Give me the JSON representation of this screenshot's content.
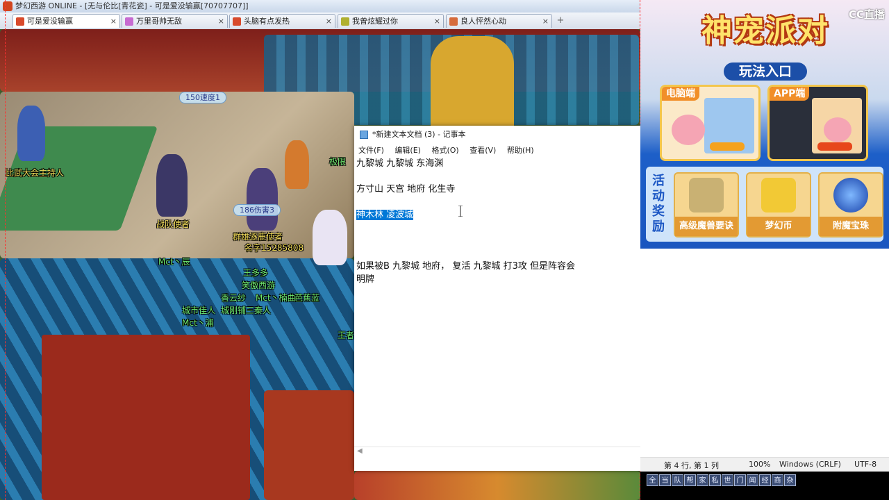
{
  "game_window": {
    "title": "梦幻西游 ONLINE - [无与伦比[青花瓷] - 可是爱没输赢[70707707]]",
    "tabs": [
      {
        "label": "可是爱没输赢",
        "active": true
      },
      {
        "label": "万里哥帅无敌",
        "active": false
      },
      {
        "label": "头脑有点发热",
        "active": false
      },
      {
        "label": "我曾炫耀过你",
        "active": false
      },
      {
        "label": "良人怦然心动",
        "active": false
      }
    ],
    "tab_close": "×",
    "tab_add": "+",
    "scene_labels": {
      "speed_tag": "150速度1",
      "damage_tag": "186伤害3",
      "host": "比武大会主持人",
      "envoy": "战队使者",
      "group_envoy": "群雄逐鹿使者",
      "name_digits": "名字15285808",
      "player_a": "Mct丶辰",
      "player_b": "王多多",
      "player_c": "笑傲西游",
      "player_d": "香云纱",
      "player_e": "Mct丶楠曲",
      "player_f": "城市佳人",
      "player_g": "城刚铺三秦人",
      "player_h": "Mct丶浦",
      "player_i": "芭蕉蓝",
      "player_j": "极限",
      "player_k": "王者"
    },
    "hotbar_keys": [
      "全",
      "当",
      "队",
      "帮",
      "家",
      "私",
      "世",
      "门",
      "闻",
      "经",
      "商",
      "杂"
    ]
  },
  "notepad": {
    "title": "*新建文本文档 (3) - 记事本",
    "menu": [
      "文件(F)",
      "编辑(E)",
      "格式(O)",
      "查看(V)",
      "帮助(H)"
    ],
    "lines": [
      "九黎城 九黎城 东海渊",
      "",
      "方寸山 天宫 地府 化生寺",
      "",
      "神木林  凌波城",
      "",
      "",
      "",
      "如果被B 九黎城 地府，  复活 九黎城 打3攻 但是阵容会",
      "明牌"
    ],
    "selected_line_index": 4,
    "status": {
      "position": "第 4 行, 第 1 列",
      "zoom": "100%",
      "line_ending": "Windows (CRLF)",
      "encoding": "UTF-8"
    }
  },
  "side_panel": {
    "platform_logo": "CC直播",
    "event_title": "神宠派对",
    "play_entry": "玩法入口",
    "cards": [
      {
        "tag": "电脑端"
      },
      {
        "tag": "APP端"
      }
    ],
    "rewards_title": "活动奖励",
    "rewards": [
      {
        "label": "高级魔兽要诀"
      },
      {
        "label": "梦幻币"
      },
      {
        "label": "附魔宝珠"
      }
    ]
  }
}
